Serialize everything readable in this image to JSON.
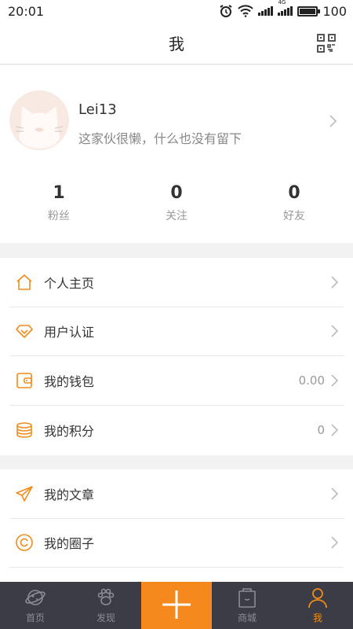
{
  "status_bar": {
    "time": "20:01",
    "network": "4G",
    "battery": "100"
  },
  "header": {
    "title": "我"
  },
  "profile": {
    "username": "Lei13",
    "bio": "这家伙很懒，什么也没有留下",
    "stats": [
      {
        "value": "1",
        "label": "粉丝"
      },
      {
        "value": "0",
        "label": "关注"
      },
      {
        "value": "0",
        "label": "好友"
      }
    ]
  },
  "menu_group_1": [
    {
      "label": "个人主页",
      "icon": "home-icon"
    },
    {
      "label": "用户认证",
      "icon": "diamond-icon"
    },
    {
      "label": "我的钱包",
      "icon": "wallet-icon",
      "value": "0.00"
    },
    {
      "label": "我的积分",
      "icon": "coins-icon",
      "value": "0"
    }
  ],
  "menu_group_2": [
    {
      "label": "我的文章",
      "icon": "paper-plane-icon"
    },
    {
      "label": "我的圈子",
      "icon": "circle-icon"
    }
  ],
  "tabbar": {
    "items": [
      {
        "label": "首页",
        "icon": "planet-icon"
      },
      {
        "label": "发现",
        "icon": "paw-icon"
      },
      {
        "label": "",
        "icon": "plus-icon"
      },
      {
        "label": "商城",
        "icon": "shopping-bag-icon"
      },
      {
        "label": "我",
        "icon": "person-icon",
        "active": true
      }
    ]
  },
  "colors": {
    "accent": "#f08c1a",
    "tabbar_bg": "#3b3c45",
    "plus_bg": "#f5891e"
  }
}
